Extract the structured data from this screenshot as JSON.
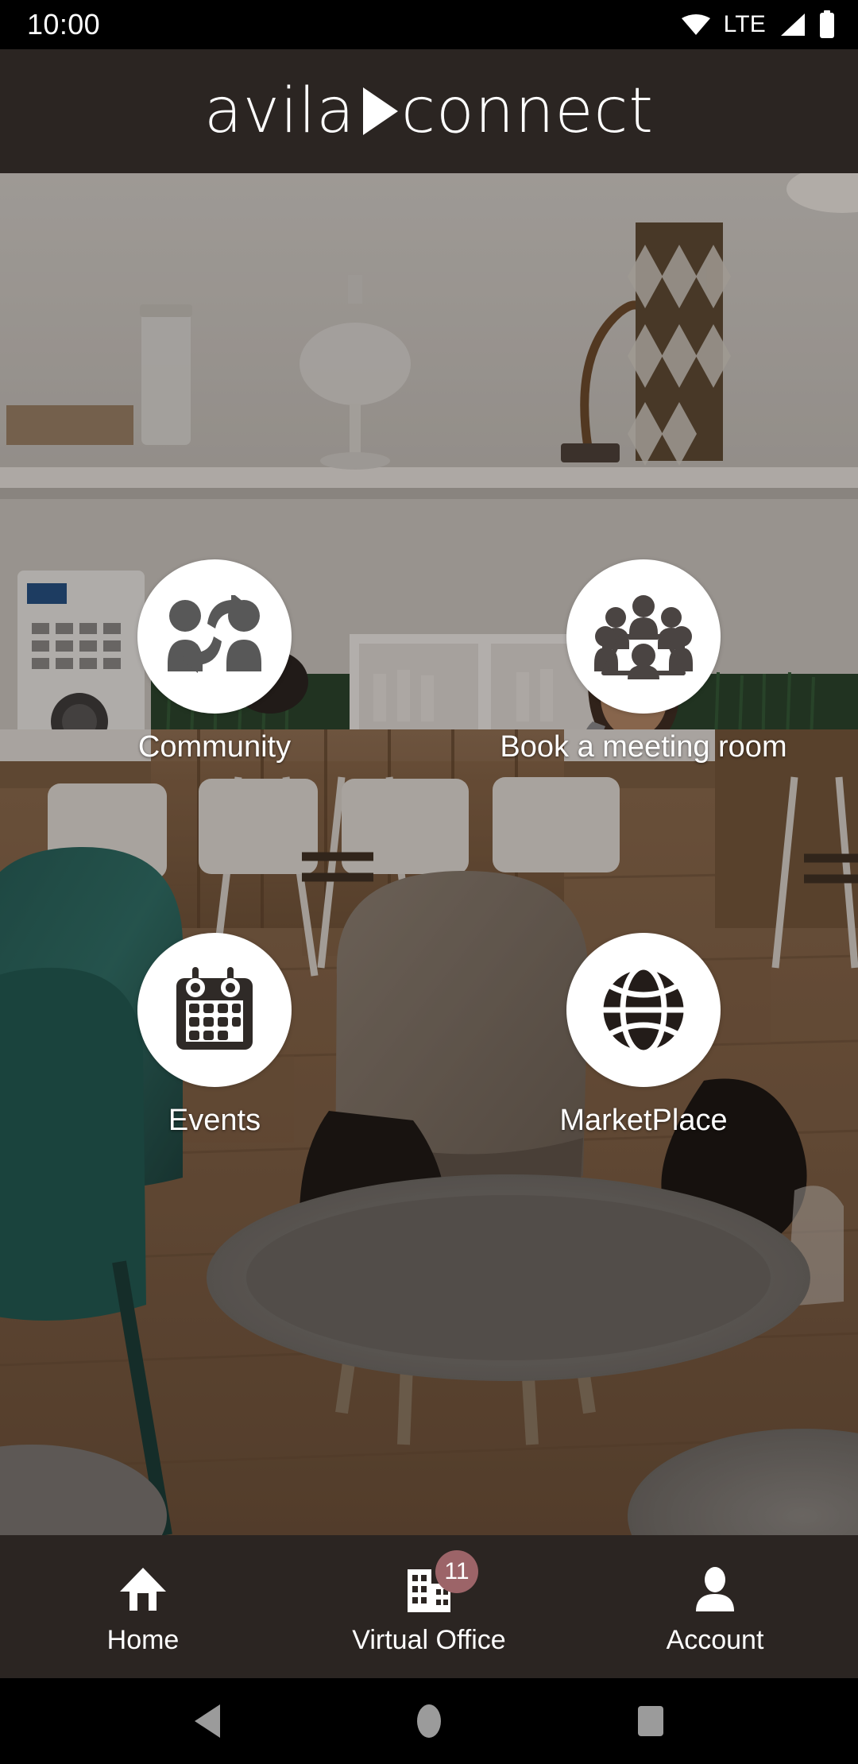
{
  "status_bar": {
    "time": "10:00",
    "network_label": "LTE",
    "icons": [
      "wifi-icon",
      "signal-icon",
      "battery-icon"
    ]
  },
  "header": {
    "logo_part1": "avila",
    "logo_part2": "connect",
    "logo_divider_icon": "play-triangle-icon",
    "background_color": "#2b2522"
  },
  "tiles": [
    {
      "label": "Community",
      "icon": "community-exchange-icon"
    },
    {
      "label": "Book a meeting room",
      "icon": "meeting-table-icon"
    },
    {
      "label": "Events",
      "icon": "calendar-icon"
    },
    {
      "label": "MarketPlace",
      "icon": "globe-icon"
    }
  ],
  "bottom_nav": {
    "items": [
      {
        "label": "Home",
        "icon": "home-icon",
        "badge": ""
      },
      {
        "label": "Virtual Office",
        "icon": "building-icon",
        "badge": "11"
      },
      {
        "label": "Account",
        "icon": "person-icon",
        "badge": ""
      }
    ],
    "badge_color": "#9c6468",
    "background_color": "#2b2522"
  },
  "android_nav": {
    "back_icon": "back-triangle-icon",
    "home_icon": "home-circle-icon",
    "recents_icon": "recents-square-icon",
    "icon_color": "#9b9b9b"
  }
}
